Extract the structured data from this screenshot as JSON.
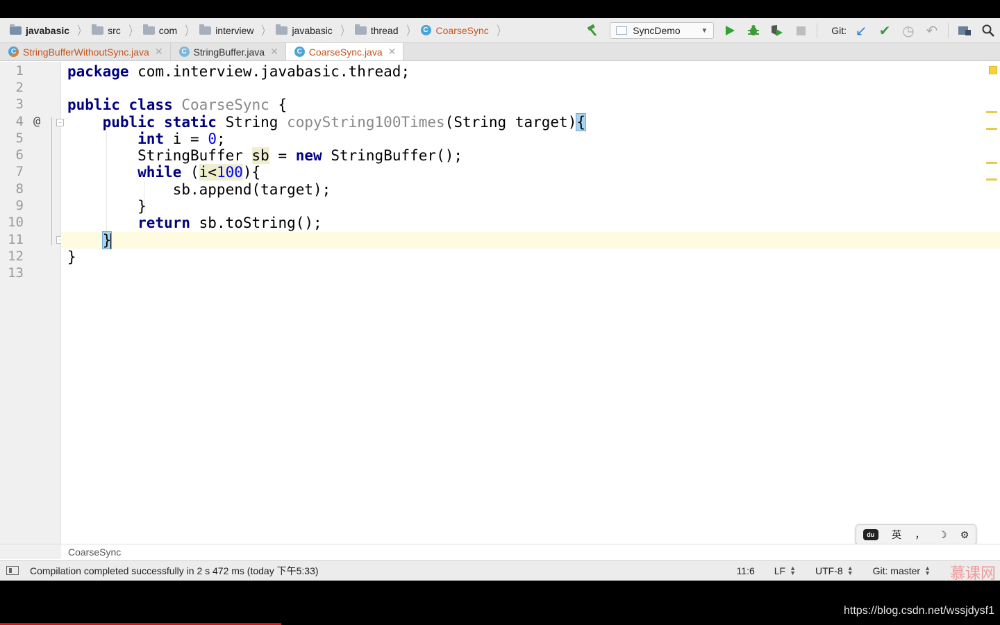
{
  "breadcrumbs": [
    {
      "label": "javabasic",
      "kind": "root"
    },
    {
      "label": "src",
      "kind": "folder"
    },
    {
      "label": "com",
      "kind": "folder"
    },
    {
      "label": "interview",
      "kind": "folder"
    },
    {
      "label": "javabasic",
      "kind": "folder"
    },
    {
      "label": "thread",
      "kind": "folder"
    },
    {
      "label": "CoarseSync",
      "kind": "class"
    }
  ],
  "toolbar": {
    "run_config": "SyncDemo",
    "git_label": "Git:"
  },
  "tabs": [
    {
      "label": "StringBufferWithoutSync.java",
      "state": "modified"
    },
    {
      "label": "StringBuffer.java",
      "state": "library"
    },
    {
      "label": "CoarseSync.java",
      "state": "active"
    }
  ],
  "editor": {
    "line_numbers": [
      "1",
      "2",
      "3",
      "4",
      "5",
      "6",
      "7",
      "8",
      "9",
      "10",
      "11",
      "12",
      "13"
    ],
    "override_marker": "@",
    "code": {
      "l1_kw": "package",
      "l1_rest": " com.interview.javabasic.thread;",
      "l3_kw": "public class",
      "l3_name": " CoarseSync",
      "l3_rest": " {",
      "l4_kw": "public static",
      "l4_type": " String ",
      "l4_method": "copyString100Times",
      "l4_args": "(String target)",
      "l4_brace": "{",
      "l5_kw": "int",
      "l5_mid": " i = ",
      "l5_num": "0",
      "l5_end": ";",
      "l6_type": "StringBuffer ",
      "l6_var": "sb",
      "l6_mid": " = ",
      "l6_kw": "new",
      "l6_end": " StringBuffer();",
      "l7_kw": "while",
      "l7_open": " (",
      "l7_cond": "i<",
      "l7_num": "100",
      "l7_close": "){",
      "l8": "sb.append(target);",
      "l9": "}",
      "l10_kw": "return",
      "l10_rest": " sb.toString();",
      "l11": "}",
      "l12": "}"
    }
  },
  "code_breadcrumb": "CoarseSync",
  "status": {
    "message": "Compilation completed successfully in 2 s 472 ms (today 下午5:33)",
    "position": "11:6",
    "line_sep": "LF",
    "encoding": "UTF-8",
    "git_branch": "Git: master"
  },
  "ime": {
    "logo": "du",
    "lang": "英",
    "punct": "，",
    "moon": "☽",
    "gear": "⚙"
  },
  "watermark_url": "https://blog.csdn.net/wssjdysf1",
  "watermark_logo": "慕课网"
}
